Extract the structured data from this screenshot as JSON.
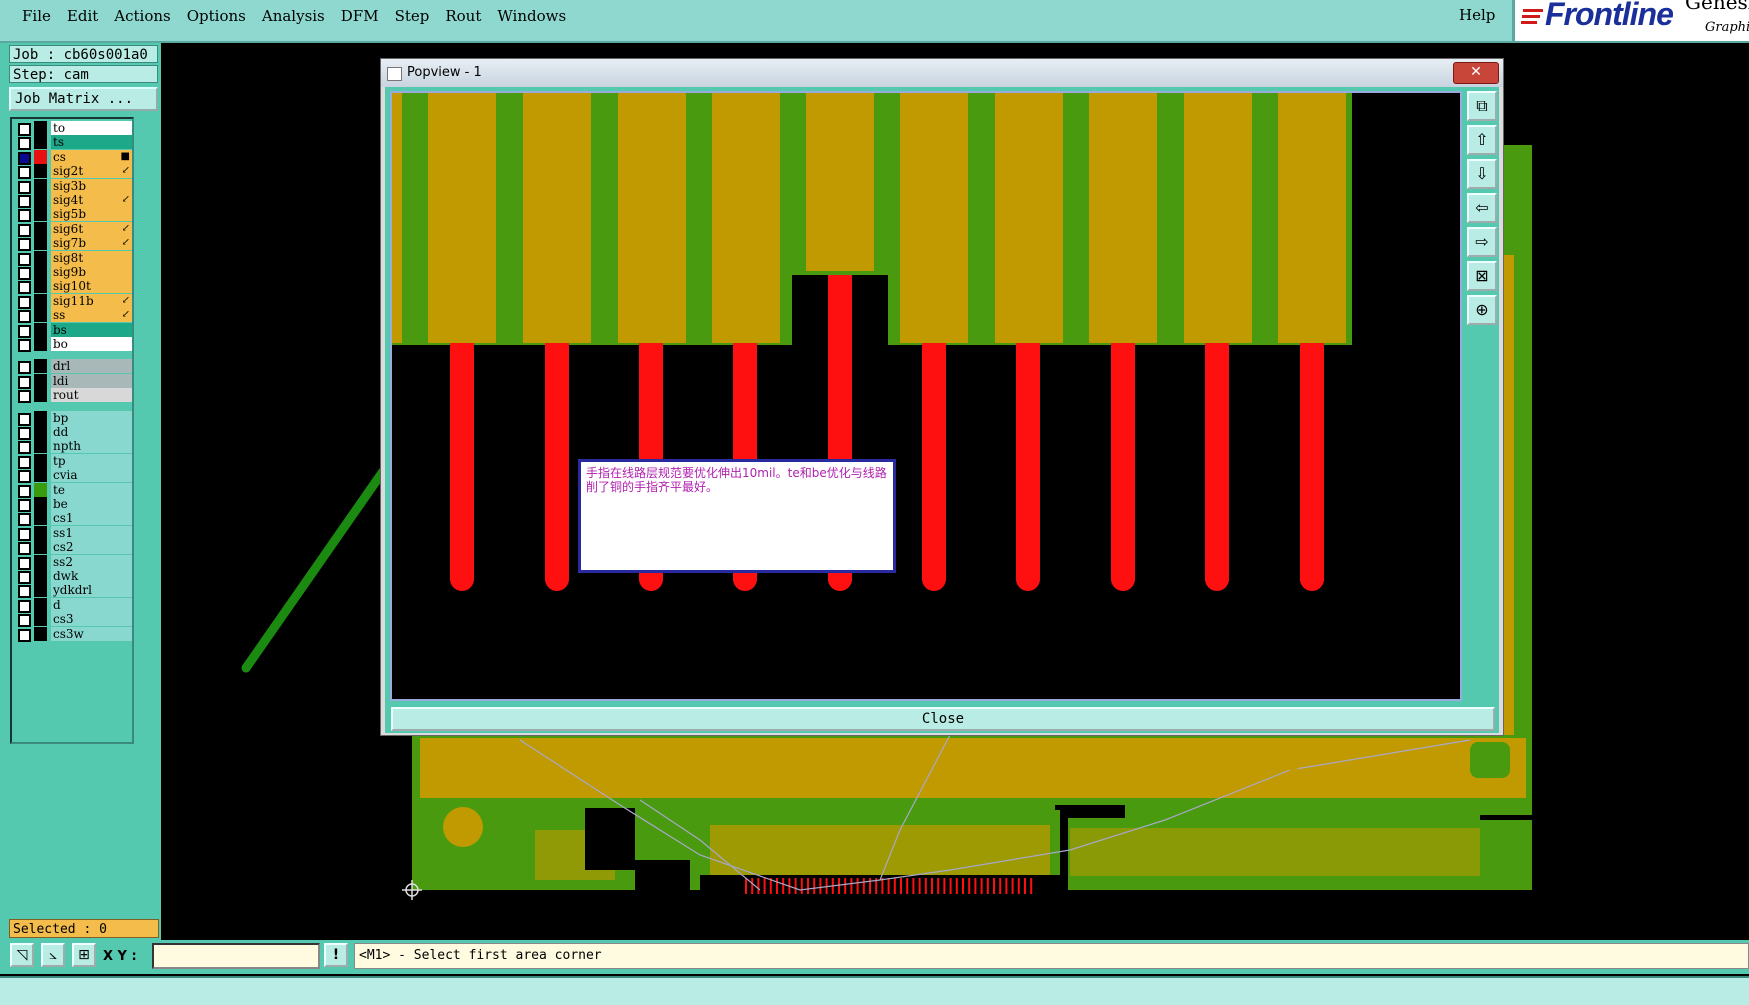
{
  "menu": {
    "items": [
      "File",
      "Edit",
      "Actions",
      "Options",
      "Analysis",
      "DFM",
      "Step",
      "Rout",
      "Windows"
    ],
    "help": "Help"
  },
  "logo": {
    "brand": "Frontline",
    "product": "Genesis",
    "sub": "Graphi"
  },
  "job": {
    "job_line": "Job : cb60s001a0",
    "step_line": "Step: cam",
    "matrix_button": "Job Matrix ..."
  },
  "layers": [
    {
      "name": "to",
      "color": "#ffffff",
      "sw": "#000000",
      "on": false,
      "mk": ""
    },
    {
      "name": "ts",
      "color": "#1ea88a",
      "sw": "#000000",
      "on": false,
      "mk": ""
    },
    {
      "name": "cs",
      "color": "#f4bc4a",
      "sw": "#e81010",
      "on": true,
      "mk": "■"
    },
    {
      "name": "sig2t",
      "color": "#f4bc4a",
      "sw": "#000000",
      "on": false,
      "mk": "↙"
    },
    {
      "name": "sig3b",
      "color": "#f4bc4a",
      "sw": "#000000",
      "on": false,
      "mk": ""
    },
    {
      "name": "sig4t",
      "color": "#f4bc4a",
      "sw": "#000000",
      "on": false,
      "mk": "↙"
    },
    {
      "name": "sig5b",
      "color": "#f4bc4a",
      "sw": "#000000",
      "on": false,
      "mk": ""
    },
    {
      "name": "sig6t",
      "color": "#f4bc4a",
      "sw": "#000000",
      "on": false,
      "mk": "↙"
    },
    {
      "name": "sig7b",
      "color": "#f4bc4a",
      "sw": "#000000",
      "on": false,
      "mk": "↙"
    },
    {
      "name": "sig8t",
      "color": "#f4bc4a",
      "sw": "#000000",
      "on": false,
      "mk": ""
    },
    {
      "name": "sig9b",
      "color": "#f4bc4a",
      "sw": "#000000",
      "on": false,
      "mk": ""
    },
    {
      "name": "sig10t",
      "color": "#f4bc4a",
      "sw": "#000000",
      "on": false,
      "mk": ""
    },
    {
      "name": "sig11b",
      "color": "#f4bc4a",
      "sw": "#000000",
      "on": false,
      "mk": "↙"
    },
    {
      "name": "ss",
      "color": "#f4bc4a",
      "sw": "#000000",
      "on": false,
      "mk": "↙"
    },
    {
      "name": "bs",
      "color": "#1ea88a",
      "sw": "#000000",
      "on": false,
      "mk": ""
    },
    {
      "name": "bo",
      "color": "#ffffff",
      "sw": "#000000",
      "on": false,
      "mk": ""
    },
    {
      "name": "drl",
      "color": "#a8b8b8",
      "sw": "#000000",
      "on": false,
      "mk": ""
    },
    {
      "name": "ldi",
      "color": "#a8b8b8",
      "sw": "#000000",
      "on": false,
      "mk": ""
    },
    {
      "name": "rout",
      "color": "#d8d8d8",
      "sw": "#000000",
      "on": false,
      "mk": ""
    },
    {
      "name": "bp",
      "color": "#88d8d0",
      "sw": "#000000",
      "on": false,
      "mk": ""
    },
    {
      "name": "dd",
      "color": "#88d8d0",
      "sw": "#000000",
      "on": false,
      "mk": ""
    },
    {
      "name": "npth",
      "color": "#88d8d0",
      "sw": "#000000",
      "on": false,
      "mk": ""
    },
    {
      "name": "tp",
      "color": "#88d8d0",
      "sw": "#000000",
      "on": false,
      "mk": ""
    },
    {
      "name": "cvia",
      "color": "#88d8d0",
      "sw": "#000000",
      "on": false,
      "mk": ""
    },
    {
      "name": "te",
      "color": "#88d8d0",
      "sw": "#3a9a10",
      "on": false,
      "mk": ""
    },
    {
      "name": "be",
      "color": "#88d8d0",
      "sw": "#000000",
      "on": false,
      "mk": ""
    },
    {
      "name": "cs1",
      "color": "#88d8d0",
      "sw": "#000000",
      "on": false,
      "mk": ""
    },
    {
      "name": "ss1",
      "color": "#88d8d0",
      "sw": "#000000",
      "on": false,
      "mk": ""
    },
    {
      "name": "cs2",
      "color": "#88d8d0",
      "sw": "#000000",
      "on": false,
      "mk": ""
    },
    {
      "name": "ss2",
      "color": "#88d8d0",
      "sw": "#000000",
      "on": false,
      "mk": ""
    },
    {
      "name": "dwk",
      "color": "#88d8d0",
      "sw": "#000000",
      "on": false,
      "mk": ""
    },
    {
      "name": "ydkdrl",
      "color": "#88d8d0",
      "sw": "#000000",
      "on": false,
      "mk": ""
    },
    {
      "name": "d",
      "color": "#88d8d0",
      "sw": "#000000",
      "on": false,
      "mk": ""
    },
    {
      "name": "cs3",
      "color": "#88d8d0",
      "sw": "#000000",
      "on": false,
      "mk": ""
    },
    {
      "name": "cs3w",
      "color": "#88d8d0",
      "sw": "#000000",
      "on": false,
      "mk": ""
    }
  ],
  "selected": "Selected : 0",
  "cmd": {
    "xy_label": "X Y :",
    "xy_value": "",
    "message": "<M1> - Select first area corner"
  },
  "popview": {
    "title": "Popview - 1",
    "close_x": "✕",
    "close_button": "Close",
    "note": "手指在线路层规范要优化伸出10mil。te和be优化与线路削了铜的手指齐平最好。"
  },
  "colors": {
    "copper": "#c09a00",
    "mask": "#4a9a10",
    "trace": "#ff1010",
    "panel": "#55c8b0"
  },
  "icons": {
    "pv_tools": [
      "zoom-fit-icon",
      "zoom-in-icon",
      "zoom-out-icon",
      "pan-left-icon",
      "pan-right-icon",
      "zoom-area-icon",
      "zoom-home-icon"
    ]
  }
}
